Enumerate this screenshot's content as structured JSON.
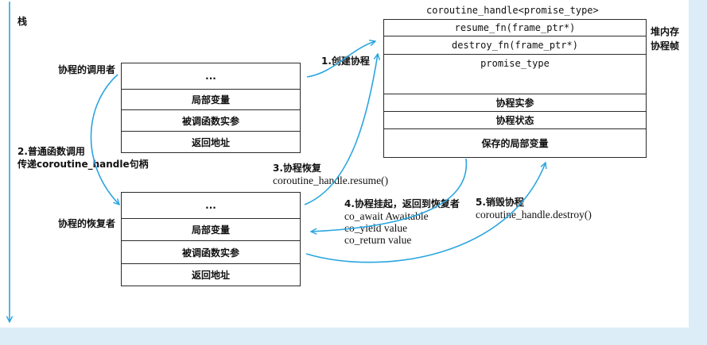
{
  "stack_label": "栈",
  "handle_title": "coroutine_handle<promise_type>",
  "frame": {
    "rows": [
      "resume_fn(frame_ptr*)",
      "destroy_fn(frame_ptr*)",
      "promise_type",
      "协程实参",
      "协程状态",
      "保存的局部变量"
    ],
    "side_labels": [
      "堆内存",
      "协程帧"
    ]
  },
  "caller": {
    "label": "协程的调用者",
    "rows": [
      "...",
      "局部变量",
      "被调函数实参",
      "返回地址"
    ]
  },
  "resumer": {
    "label": "协程的恢复者",
    "rows": [
      "...",
      "局部变量",
      "被调函数实参",
      "返回地址"
    ]
  },
  "steps": {
    "create": [
      "1.创建协程"
    ],
    "call": [
      "2.普通函数调用",
      "传递coroutine_handle句柄"
    ],
    "resume": [
      "3.协程恢复",
      "coroutine_handle.resume()"
    ],
    "suspend": [
      "4.协程挂起，返回到恢复者",
      "co_await Awaitable",
      "co_yield value",
      "co_return value"
    ],
    "destroy": [
      "5.销毁协程",
      "coroutine_handle.destroy()"
    ]
  },
  "colors": {
    "arrow": "#2aa6df",
    "margin_tint": "#dcedf8",
    "box_line": "#2b2b2b"
  }
}
